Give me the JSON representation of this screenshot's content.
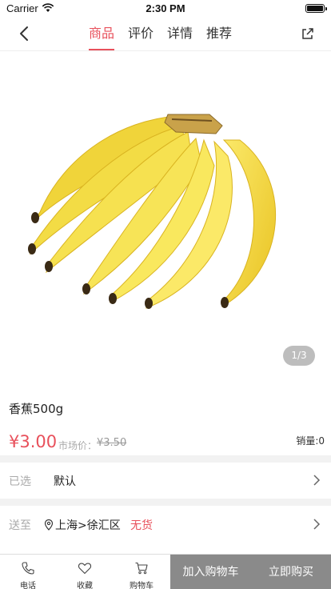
{
  "status_bar": {
    "carrier": "Carrier",
    "time": "2:30 PM"
  },
  "nav": {
    "tabs": [
      {
        "label": "商品",
        "active": true
      },
      {
        "label": "评价",
        "active": false
      },
      {
        "label": "详情",
        "active": false
      },
      {
        "label": "推荐",
        "active": false
      }
    ],
    "back_icon": "chevron-left-icon",
    "share_icon": "share-icon"
  },
  "hero": {
    "pager": "1/3"
  },
  "product": {
    "name": "香蕉500g",
    "price": "¥3.00",
    "market_label": "市场价：",
    "market_price": "¥3.50",
    "sales": "销量:0"
  },
  "selected": {
    "label": "已选",
    "value": "默认"
  },
  "delivery": {
    "label": "送至",
    "location": "上海>徐汇区",
    "stock": "无货"
  },
  "bottom_bar": {
    "phone": "电话",
    "favorite": "收藏",
    "cart": "购物车",
    "add_to_cart": "加入购物车",
    "buy_now": "立即购买"
  },
  "colors": {
    "accent": "#e8505b",
    "button_gray": "#8a8a8a",
    "divider": "#f2f2f2"
  }
}
